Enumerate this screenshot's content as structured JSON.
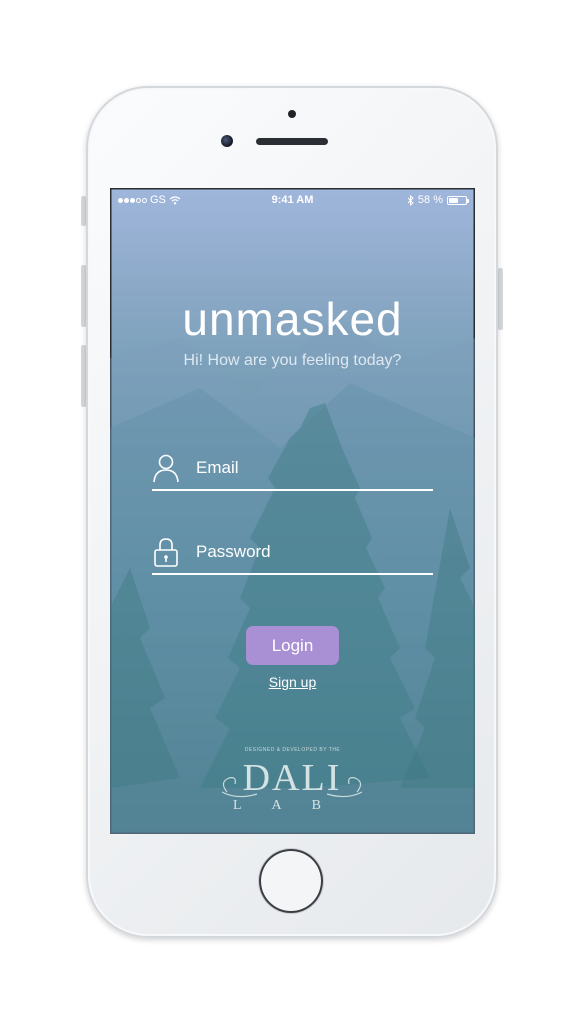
{
  "status_bar": {
    "carrier": "GS",
    "time": "9:41 AM",
    "battery": "58 %",
    "battery_level": 0.58
  },
  "app": {
    "title": "unmasked",
    "subtitle": "Hi! How are you feeling today?"
  },
  "form": {
    "email_placeholder": "Email",
    "email_value": "",
    "password_placeholder": "Password",
    "password_value": "",
    "login_label": "Login",
    "signup_label": "Sign up"
  },
  "credit": {
    "caption": "DESIGNED & DEVELOPED BY THE",
    "logo_main": "DALI",
    "logo_sub": "LAB"
  },
  "colors": {
    "accent": "#a98fd3",
    "gradient_top": "#a0b6dc",
    "gradient_bottom": "#326e72"
  }
}
